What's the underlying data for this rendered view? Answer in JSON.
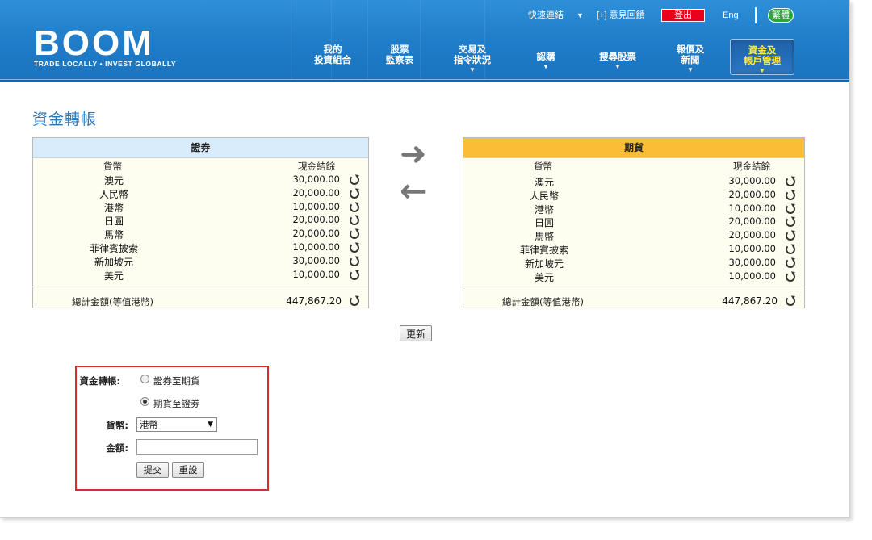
{
  "header": {
    "logo_word": "BOOM",
    "logo_tagline": "TRADE LOCALLY • INVEST GLOBALLY",
    "quick_links": "快速連結",
    "quick_links_arrow": "▼",
    "feedback": "[+] 意見回饋",
    "logout": "登出",
    "lang_eng": "Eng",
    "lang_trad": "繁體"
  },
  "nav": {
    "items": [
      {
        "line1": "我的",
        "line2": "投資組合",
        "arrow": ""
      },
      {
        "line1": "股票",
        "line2": "監察表",
        "arrow": ""
      },
      {
        "line1": "交易及",
        "line2": "指令狀況",
        "arrow": "▼"
      },
      {
        "line1": "認購",
        "line2": "",
        "arrow": "▼"
      },
      {
        "line1": "搜尋股票",
        "line2": "",
        "arrow": "▼"
      },
      {
        "line1": "報價及",
        "line2": "新聞",
        "arrow": "▼"
      },
      {
        "line1": "資金及",
        "line2": "帳戶管理",
        "arrow": "▼"
      }
    ]
  },
  "page": {
    "title": "資金轉帳",
    "update_button": "更新"
  },
  "securities": {
    "title": "證券",
    "col_currency": "貨幣",
    "col_balance": "現金結餘",
    "rows": [
      {
        "currency": "澳元",
        "balance": "30,000.00"
      },
      {
        "currency": "人民幣",
        "balance": "20,000.00"
      },
      {
        "currency": "港幣",
        "balance": "10,000.00"
      },
      {
        "currency": "日圓",
        "balance": "20,000.00"
      },
      {
        "currency": "馬幣",
        "balance": "20,000.00"
      },
      {
        "currency": "菲律賓披索",
        "balance": "10,000.00"
      },
      {
        "currency": "新加坡元",
        "balance": "30,000.00"
      },
      {
        "currency": "美元",
        "balance": "10,000.00"
      }
    ],
    "total_label": "總計金額(等值港幣)",
    "total_value": "447,867.20"
  },
  "futures": {
    "title": "期貨",
    "col_currency": "貨幣",
    "col_balance": "現金結餘",
    "rows": [
      {
        "currency": "澳元",
        "balance": "30,000.00"
      },
      {
        "currency": "人民幣",
        "balance": "20,000.00"
      },
      {
        "currency": "港幣",
        "balance": "10,000.00"
      },
      {
        "currency": "日圓",
        "balance": "20,000.00"
      },
      {
        "currency": "馬幣",
        "balance": "20,000.00"
      },
      {
        "currency": "菲律賓披索",
        "balance": "10,000.00"
      },
      {
        "currency": "新加坡元",
        "balance": "30,000.00"
      },
      {
        "currency": "美元",
        "balance": "10,000.00"
      }
    ],
    "total_label": "總計金額(等值港幣)",
    "total_value": "447,867.20"
  },
  "arrows": {
    "right": "➜",
    "left": "←"
  },
  "form": {
    "transfer_label": "資金轉帳:",
    "option_sec_to_fut": "證券至期貨",
    "option_fut_to_sec": "期貨至證券",
    "selected_option": "fut_to_sec",
    "currency_label": "貨幣:",
    "currency_value": "港幣",
    "currency_caret": "▼",
    "amount_label": "金額:",
    "amount_value": "",
    "submit_button": "提交",
    "reset_button": "重設"
  },
  "colors": {
    "header_blue": "#1f7cc8",
    "securities_header": "#d9ecfb",
    "futures_header": "#fbbd36",
    "logout_red": "#e8001c",
    "form_border": "#d92d2d",
    "title_blue": "#2878b8"
  }
}
